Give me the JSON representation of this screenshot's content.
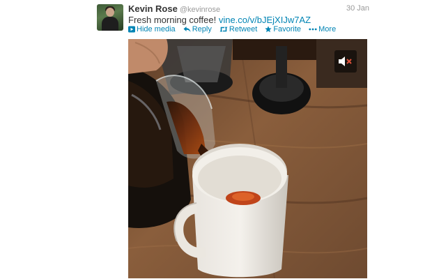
{
  "tweet": {
    "author": {
      "name": "Kevin Rose",
      "handle": "@kevinrose",
      "avatar_icon": "profile-photo"
    },
    "timestamp": "30 Jan",
    "text": "Fresh morning coffee! ",
    "link": "vine.co/v/bJEjXIJw7AZ",
    "actions": [
      {
        "label": "Hide media",
        "icon": "media-icon"
      },
      {
        "label": "Reply",
        "icon": "reply-icon"
      },
      {
        "label": "Retweet",
        "icon": "retweet-icon"
      },
      {
        "label": "Favorite",
        "icon": "star-icon"
      },
      {
        "label": "More",
        "icon": "ellipsis-icon"
      }
    ],
    "media": {
      "type": "video",
      "mute_icon": "speaker-muted-icon",
      "colors": {
        "mute_x": "#e0523a",
        "link": "#0084b4"
      }
    }
  }
}
